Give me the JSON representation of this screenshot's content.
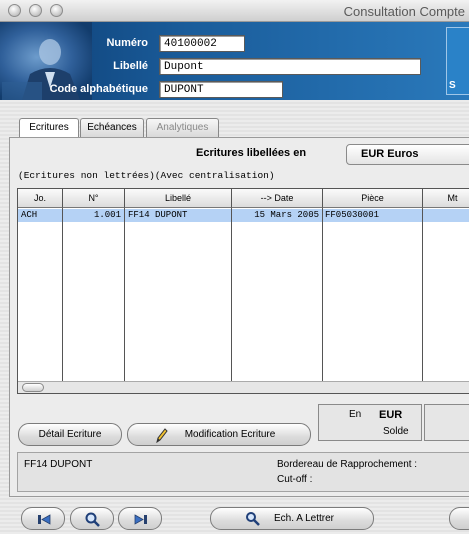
{
  "window": {
    "title": "Consultation Compte"
  },
  "header": {
    "numero_label": "Numéro",
    "numero_value": "40100002",
    "libelle_label": "Libellé",
    "libelle_value": "Dupont",
    "code_label": "Code alphabétique",
    "code_value": "DUPONT",
    "side_letter": "S"
  },
  "tabs": [
    {
      "label": "Ecritures",
      "active": true
    },
    {
      "label": "Echéances",
      "active": false
    },
    {
      "label": "Analytiques",
      "disabled": true
    }
  ],
  "main": {
    "currency_label": "Ecritures libellées en",
    "currency_value": "EUR  Euros",
    "filter_text": "(Ecritures non lettrées)(Avec centralisation)"
  },
  "table": {
    "columns": [
      "Jo.",
      "N°",
      "Libellé",
      "--> Date",
      "Pièce",
      "Mt"
    ],
    "rows": [
      {
        "jo": "ACH",
        "num": "1.001",
        "libelle": "FF14 DUPONT",
        "date": "15 Mars 2005",
        "piece": "FF05030001",
        "mt": ""
      }
    ]
  },
  "actions": {
    "detail_label": "Détail Ecriture",
    "modify_label": "Modification Ecriture"
  },
  "solde": {
    "en_label": "En",
    "currency": "EUR",
    "label": "Solde"
  },
  "info": {
    "account_text": "FF14 DUPONT",
    "bordereau_label": "Bordereau de Rapprochement :",
    "cutoff_label": "Cut-off :"
  },
  "footer": {
    "lettrer_label": "Ech. A Lettrer"
  },
  "colors": {
    "header_blue": "#1a5c9a",
    "selection": "#b5d2f5"
  }
}
